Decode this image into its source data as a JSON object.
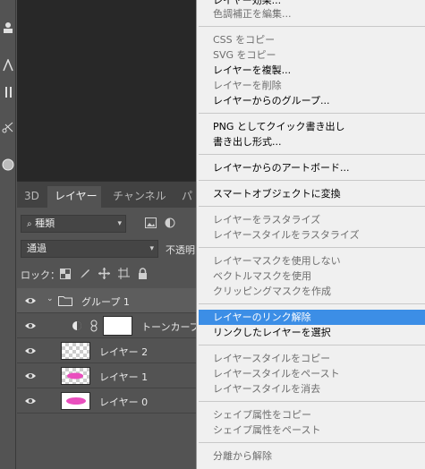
{
  "toolbar": {
    "tools": [
      "person-tool-icon",
      "type-tool-icon",
      "path-select-tool-icon",
      "scissors-tool-icon",
      "ellipse-tool-icon"
    ]
  },
  "layers_panel": {
    "tabs": [
      "3D",
      "レイヤー",
      "チャンネル",
      "パ"
    ],
    "active_tab": "レイヤー",
    "filter_label": "種類",
    "blend_mode": "通過",
    "opacity_label": "不透明",
    "lock_label": "ロック：",
    "layers": [
      {
        "name": "グループ 1",
        "type": "group",
        "expanded": true
      },
      {
        "name": "トーンカーブ",
        "type": "adjustment"
      },
      {
        "name": "レイヤー 2",
        "type": "pixel"
      },
      {
        "name": "レイヤー 1",
        "type": "pixel"
      },
      {
        "name": "レイヤー 0",
        "type": "pixel"
      }
    ]
  },
  "context_menu": {
    "items": [
      {
        "label": "レイヤー効果...",
        "enabled": true
      },
      {
        "label": "色調補正を編集...",
        "enabled": false
      },
      {
        "label": "CSS をコピー",
        "enabled": false
      },
      {
        "label": "SVG をコピー",
        "enabled": false
      },
      {
        "label": "レイヤーを複製...",
        "enabled": true
      },
      {
        "label": "レイヤーを削除",
        "enabled": false
      },
      {
        "label": "レイヤーからのグループ...",
        "enabled": true
      },
      {
        "label": "PNG としてクイック書き出し",
        "enabled": true
      },
      {
        "label": "書き出し形式...",
        "enabled": true
      },
      {
        "label": "レイヤーからのアートボード...",
        "enabled": true
      },
      {
        "label": "スマートオブジェクトに変換",
        "enabled": true
      },
      {
        "label": "レイヤーをラスタライズ",
        "enabled": false
      },
      {
        "label": "レイヤースタイルをラスタライズ",
        "enabled": false
      },
      {
        "label": "レイヤーマスクを使用しない",
        "enabled": false
      },
      {
        "label": "ベクトルマスクを使用",
        "enabled": false
      },
      {
        "label": "クリッピングマスクを作成",
        "enabled": false
      },
      {
        "label": "レイヤーのリンク解除",
        "enabled": true,
        "highlighted": true
      },
      {
        "label": "リンクしたレイヤーを選択",
        "enabled": true
      },
      {
        "label": "レイヤースタイルをコピー",
        "enabled": false
      },
      {
        "label": "レイヤースタイルをペースト",
        "enabled": false
      },
      {
        "label": "レイヤースタイルを消去",
        "enabled": false
      },
      {
        "label": "シェイプ属性をコピー",
        "enabled": false
      },
      {
        "label": "シェイプ属性をペースト",
        "enabled": false
      },
      {
        "label": "分離から解除",
        "enabled": false
      }
    ]
  },
  "colors": {
    "panel_bg": "#535353",
    "canvas_bg": "#282828",
    "menu_bg": "#f0f0f0",
    "highlight": "#3c8ee6",
    "layer_art": "#e94fbe"
  }
}
